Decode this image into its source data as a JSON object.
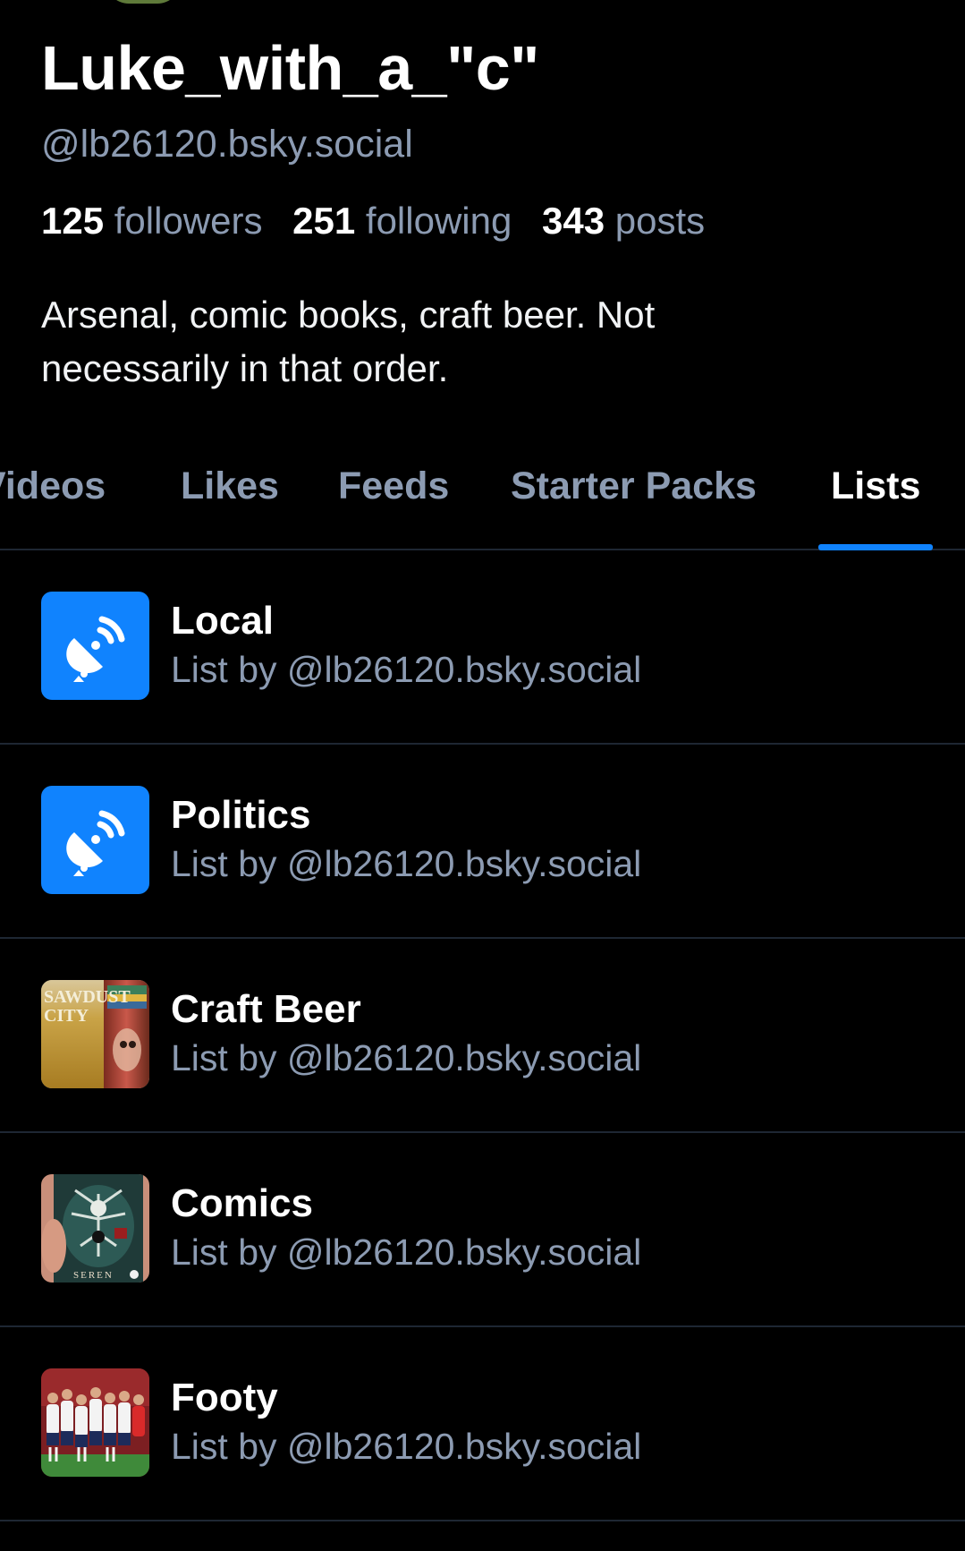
{
  "profile": {
    "display_name": "Luke_with_a_\"c\"",
    "handle": "@lb26120.bsky.social",
    "followers_count": "125",
    "followers_label": "followers",
    "following_count": "251",
    "following_label": "following",
    "posts_count": "343",
    "posts_label": "posts",
    "bio": "Arsenal, comic books, craft beer. Not necessarily in that order."
  },
  "tabs": [
    {
      "label": "Videos",
      "active": false
    },
    {
      "label": "Likes",
      "active": false
    },
    {
      "label": "Feeds",
      "active": false
    },
    {
      "label": "Starter Packs",
      "active": false
    },
    {
      "label": "Lists",
      "active": true
    }
  ],
  "colors": {
    "background": "#000000",
    "accent": "#1083fe",
    "muted_text": "#8c9bb2",
    "divider": "#1e2733"
  },
  "lists": [
    {
      "title": "Local",
      "subtitle": "List by @lb26120.bsky.social",
      "avatar": "default-list-icon"
    },
    {
      "title": "Politics",
      "subtitle": "List by @lb26120.bsky.social",
      "avatar": "default-list-icon"
    },
    {
      "title": "Craft Beer",
      "subtitle": "List by @lb26120.bsky.social",
      "avatar": "beer-can-photo",
      "avatar_text": "SAWDUST CITY"
    },
    {
      "title": "Comics",
      "subtitle": "List by @lb26120.bsky.social",
      "avatar": "comic-cover-photo",
      "avatar_text": "SEREN"
    },
    {
      "title": "Footy",
      "subtitle": "List by @lb26120.bsky.social",
      "avatar": "football-team-photo"
    }
  ]
}
